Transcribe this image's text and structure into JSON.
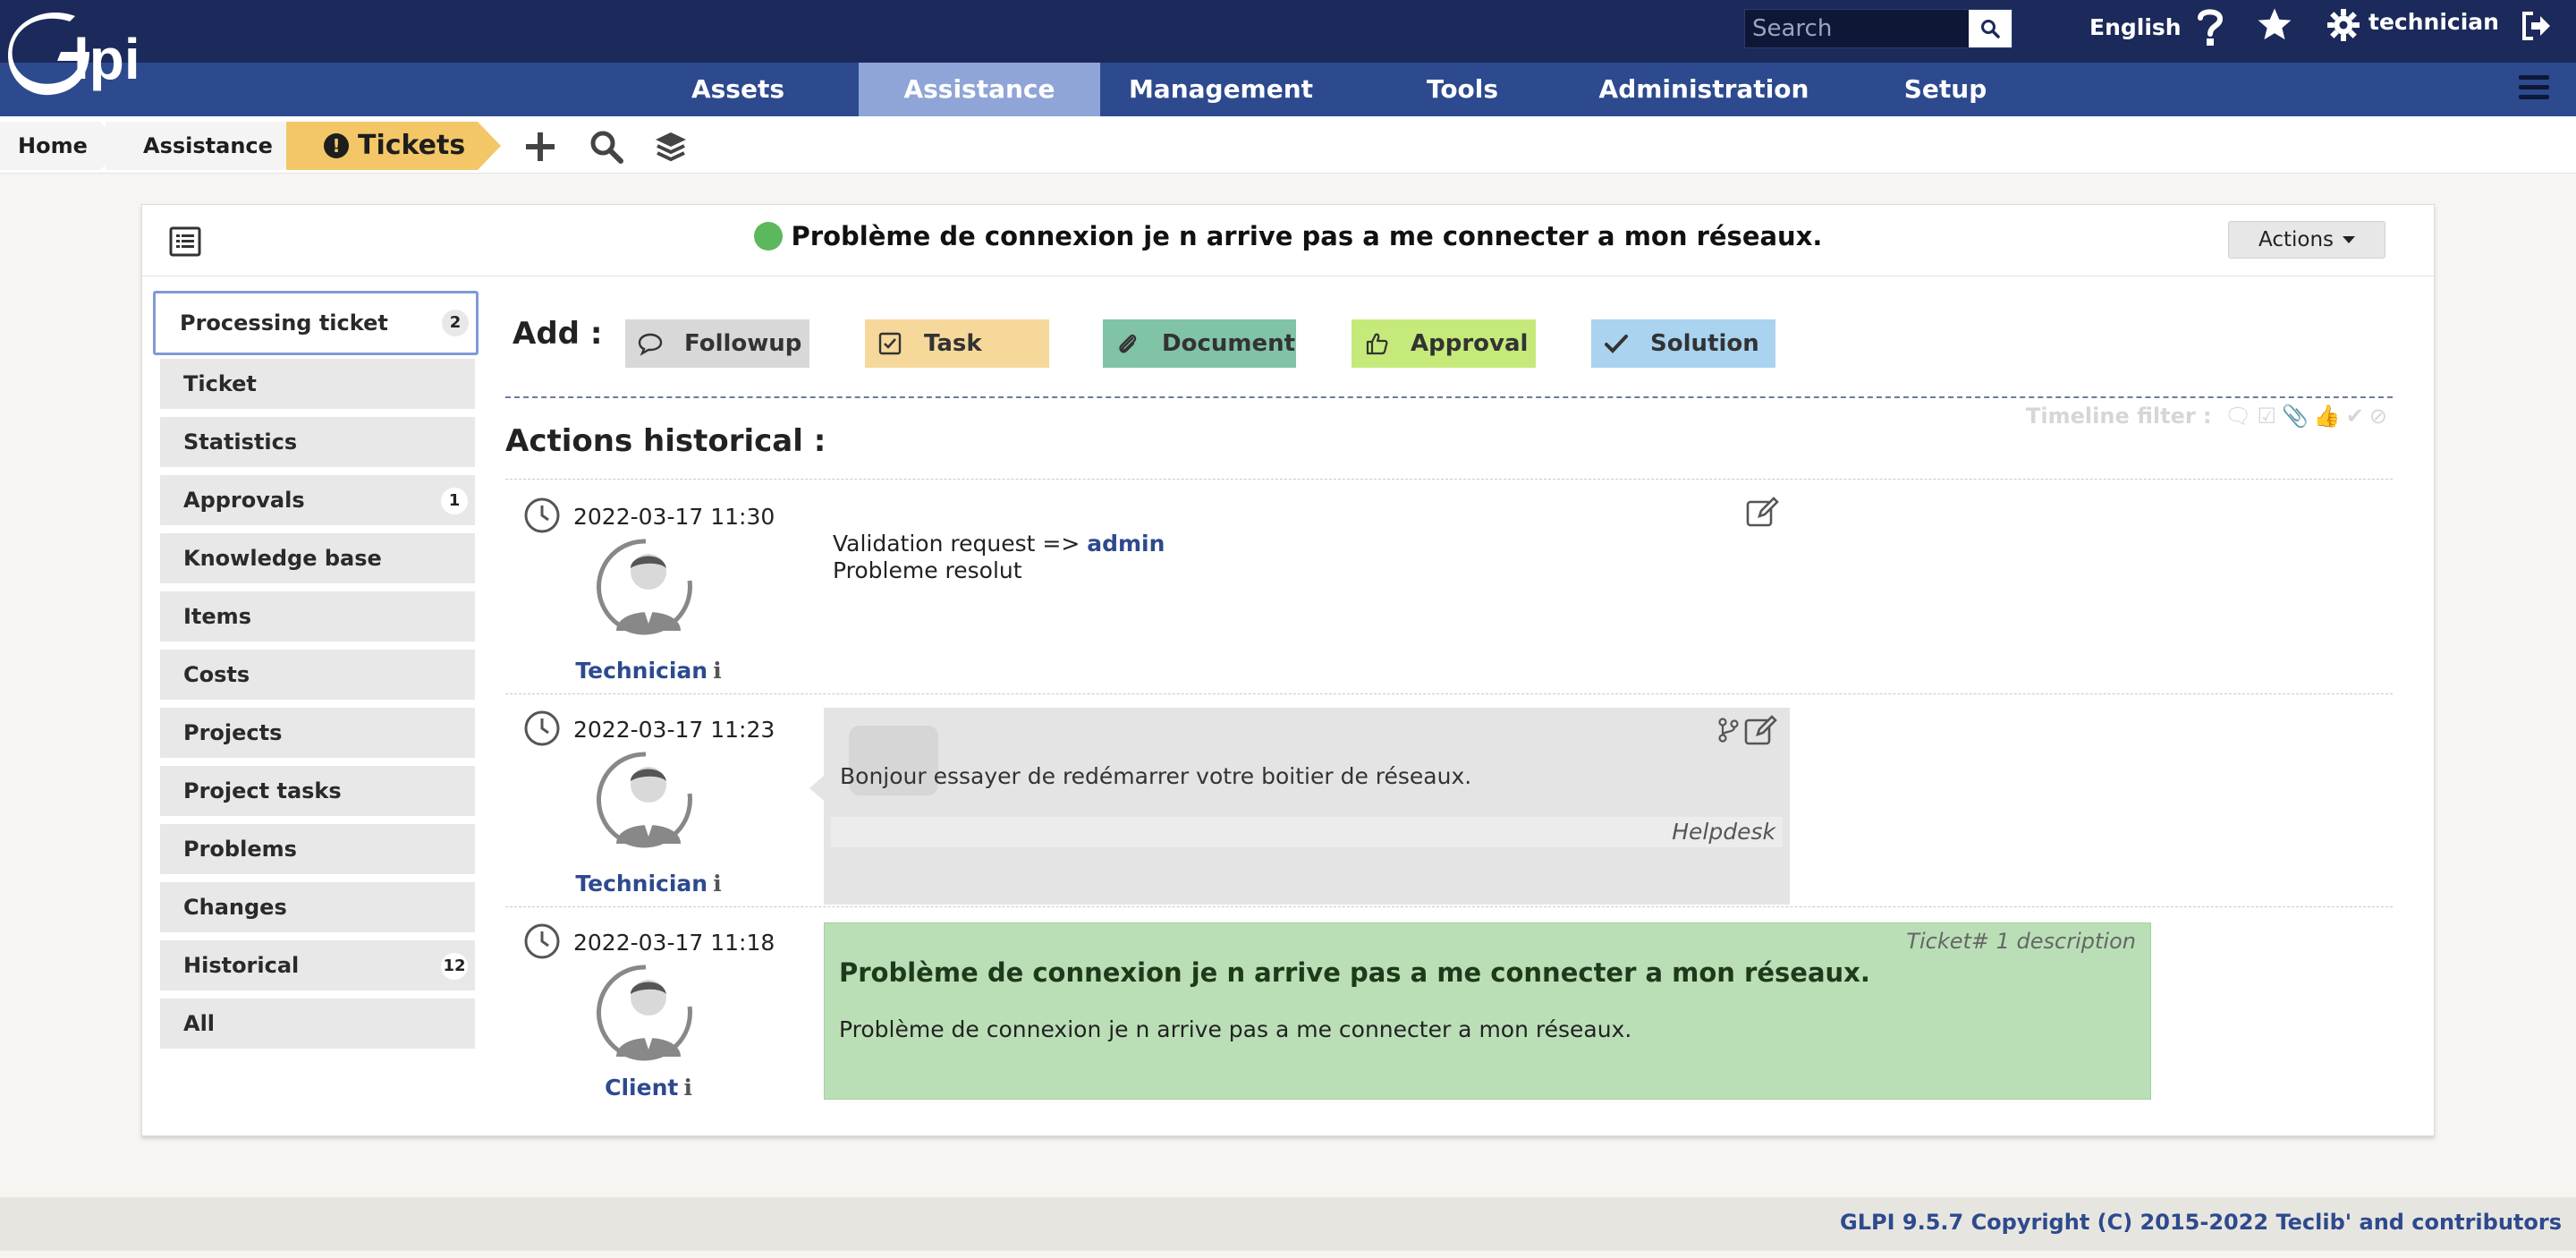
{
  "header": {
    "search_placeholder": "Search",
    "language": "English",
    "user": "technician",
    "logo_text": "Glpi"
  },
  "menu": [
    "Assets",
    "Assistance",
    "Management",
    "Tools",
    "Administration",
    "Setup"
  ],
  "breadcrumb": [
    "Home",
    "Assistance",
    "Tickets"
  ],
  "ticket": {
    "title": "Problème de connexion je n arrive pas a me connecter a mon réseaux.",
    "status_color": "#5cb85c",
    "actions_label": "Actions"
  },
  "tabs": [
    {
      "label": "Processing ticket",
      "badge": "2"
    },
    {
      "label": "Ticket",
      "badge": ""
    },
    {
      "label": "Statistics",
      "badge": ""
    },
    {
      "label": "Approvals",
      "badge": "1"
    },
    {
      "label": "Knowledge base",
      "badge": ""
    },
    {
      "label": "Items",
      "badge": ""
    },
    {
      "label": "Costs",
      "badge": ""
    },
    {
      "label": "Projects",
      "badge": ""
    },
    {
      "label": "Project tasks",
      "badge": ""
    },
    {
      "label": "Problems",
      "badge": ""
    },
    {
      "label": "Changes",
      "badge": ""
    },
    {
      "label": "Historical",
      "badge": "12"
    },
    {
      "label": "All",
      "badge": ""
    }
  ],
  "add": {
    "label": "Add :",
    "buttons": [
      {
        "label": "Followup",
        "color": "#d8d8d8"
      },
      {
        "label": "Task",
        "color": "#f6d89b"
      },
      {
        "label": "Document",
        "color": "#80c3a6"
      },
      {
        "label": "Approval",
        "color": "#c5ea7a"
      },
      {
        "label": "Solution",
        "color": "#a9d3ef"
      }
    ]
  },
  "history": {
    "title": "Actions historical :",
    "filter_label": "Timeline filter :",
    "entries": [
      {
        "date": "2022-03-17 11:30",
        "author": "Technician",
        "line1_prefix": "Validation request => ",
        "line1_link": "admin",
        "line2": "Probleme resolut"
      },
      {
        "date": "2022-03-17 11:23",
        "author": "Technician",
        "text": "Bonjour essayer de redémarrer votre boitier de réseaux.",
        "source": "Helpdesk"
      },
      {
        "date": "2022-03-17 11:18",
        "author": "Client",
        "tag": "Ticket# 1 description",
        "title": "Problème de connexion je n arrive pas a me connecter a mon réseaux.",
        "text": "Problème de connexion je n arrive pas a me connecter a mon réseaux."
      }
    ]
  },
  "footer": "GLPI 9.5.7 Copyright (C) 2015-2022 Teclib' and contributors"
}
